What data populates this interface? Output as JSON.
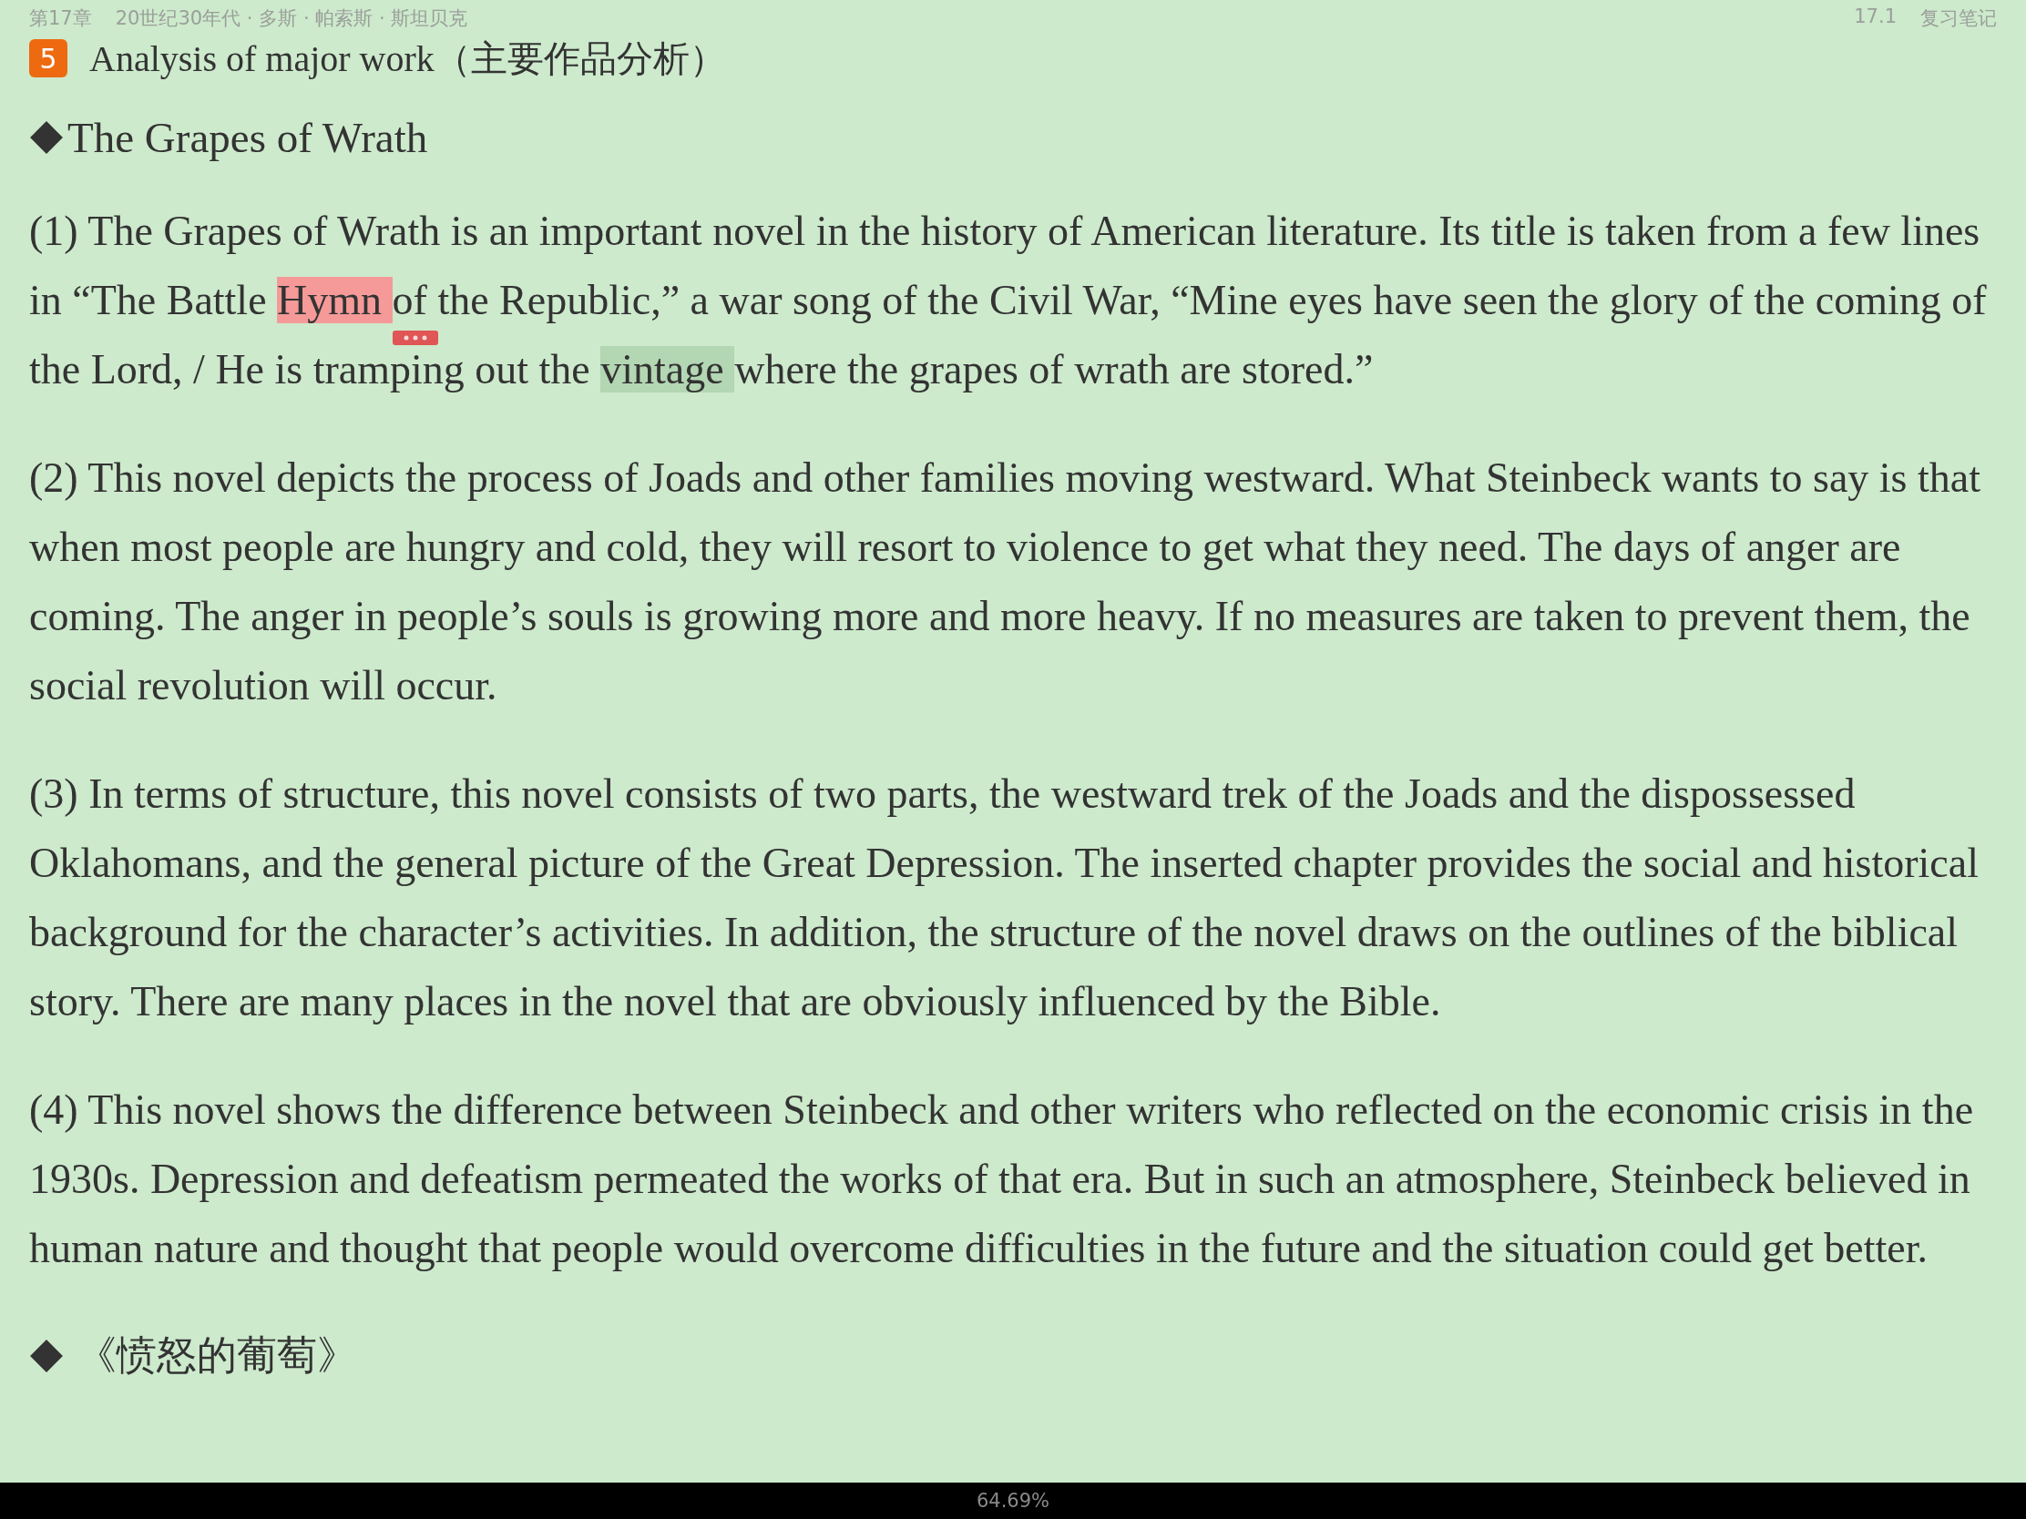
{
  "header": {
    "chapter": "第17章",
    "section_path": "20世纪30年代 · 多斯 · 帕索斯 · 斯坦贝克",
    "section_number": "17.1",
    "section_title": "复习笔记"
  },
  "cut_heading": {
    "badge": "5",
    "text": "Analysis of major work（主要作品分析）"
  },
  "blocks": [
    {
      "kind": "heading",
      "text": "The Grapes of Wrath"
    },
    {
      "kind": "paragraph",
      "segments": [
        {
          "text": "(1) The Grapes of Wrath is an important novel in the history of American literature. Its title is taken from a few lines in “The Battle ",
          "highlighted": false,
          "selected": false
        },
        {
          "text": "Hymn ",
          "highlighted": true,
          "selected": false
        },
        {
          "text": "of the Republic,” a war song of the Civil War, “Mine eyes have seen the glory of the coming of the Lord, / He is tramping out the ",
          "highlighted": false,
          "selected": false
        },
        {
          "text": "vintage ",
          "highlighted": false,
          "selected": true
        },
        {
          "text": "where the grapes of wrath are stored.”",
          "highlighted": false,
          "selected": false
        }
      ]
    },
    {
      "kind": "paragraph",
      "segments": [
        {
          "text": "(2) This novel depicts the process of Joads and other families moving westward. What Steinbeck wants to say is that when most people are hungry and cold, they will resort to violence to get what they need. The days of anger are coming. The anger in people’s souls is growing more and more heavy. If no measures are taken to prevent them, the social revolution will occur.",
          "highlighted": false,
          "selected": false
        }
      ]
    },
    {
      "kind": "paragraph",
      "segments": [
        {
          "text": "(3) In terms of structure, this novel consists of two parts, the westward trek of the Joads and the dispossessed Oklahomans, and the general picture of the Great Depression. The inserted chapter provides the social and historical background for the character’s activities. In addition, the structure of the novel draws on the outlines of the biblical story. There are many places in the novel that are obviously influenced by the Bible.",
          "highlighted": false,
          "selected": false
        }
      ]
    },
    {
      "kind": "paragraph",
      "segments": [
        {
          "text": "(4) This novel shows the difference between Steinbeck and other writers who reflected on the economic crisis in the 1930s. Depression and defeatism permeated the works of that era. But in such an atmosphere, Steinbeck believed in human nature and thought that people would overcome difficulties in the future and the situation could get better.",
          "highlighted": false,
          "selected": false
        }
      ]
    },
    {
      "kind": "heading",
      "text": "《愤怒的葡萄》"
    }
  ],
  "status_bar": {
    "progress": "64.69%"
  }
}
